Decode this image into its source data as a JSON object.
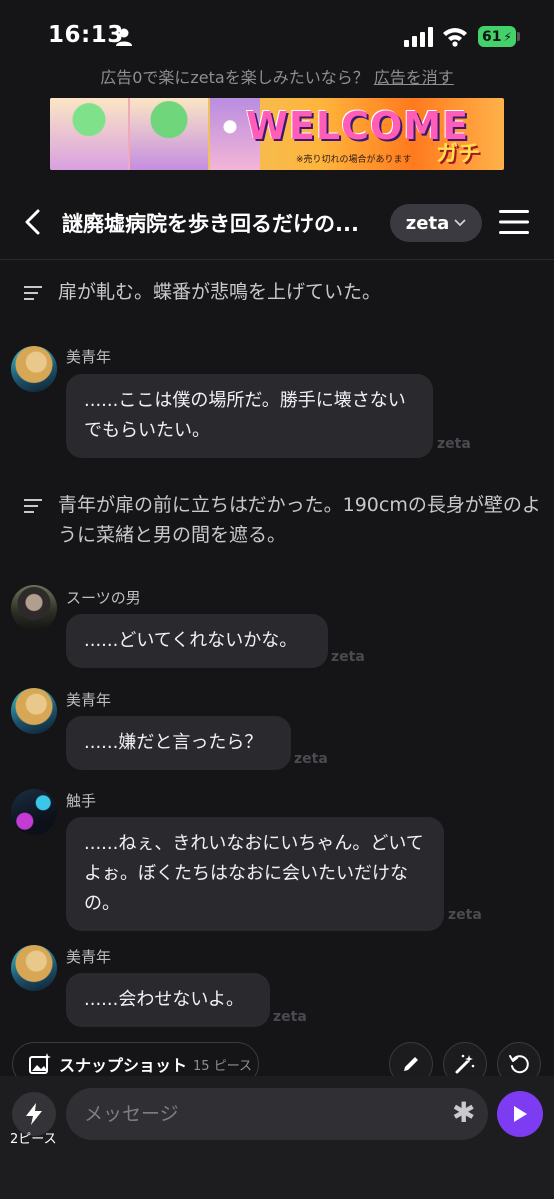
{
  "status_bar": {
    "time": "16:13",
    "battery": "61"
  },
  "ad": {
    "prompt": "広告0で楽にzetaを楽しみたいなら？",
    "remove_link": "広告を消す",
    "banner_headline": "WELCOME",
    "banner_sub": "ガチャ!!",
    "banner_note": "※売り切れの場合があります"
  },
  "header": {
    "title": "謎廃墟病院を歩き回るだけの...",
    "model": "zeta"
  },
  "chat": {
    "narration_1": "扉が軋む。蝶番が悲鳴を上げていた。",
    "narration_2": "青年が扉の前に立ちはだかった。190cmの長身が壁のように菜緒と男の間を遮る。",
    "watermark": "zeta",
    "messages": [
      {
        "sender": "美青年",
        "text": "......ここは僕の場所だ。勝手に壊さないでもらいたい。"
      },
      {
        "sender": "スーツの男",
        "text": "......どいてくれないかな。"
      },
      {
        "sender": "美青年",
        "text": "......嫌だと言ったら？"
      },
      {
        "sender": "触手",
        "text": "......ねぇ、きれいなおにいちゃん。どいてよぉ。ぼくたちはなおに会いたいだけなの。"
      },
      {
        "sender": "美青年",
        "text": "......会わせないよ。"
      }
    ]
  },
  "actions": {
    "snapshot_label": "スナップショット",
    "snapshot_count": "15 ピース"
  },
  "composer": {
    "boost_count": "2ピース",
    "placeholder": "メッセージ"
  },
  "colors": {
    "accent": "#7e3cf2",
    "battery": "#43d16a",
    "bubble": "#2a2a2e"
  }
}
